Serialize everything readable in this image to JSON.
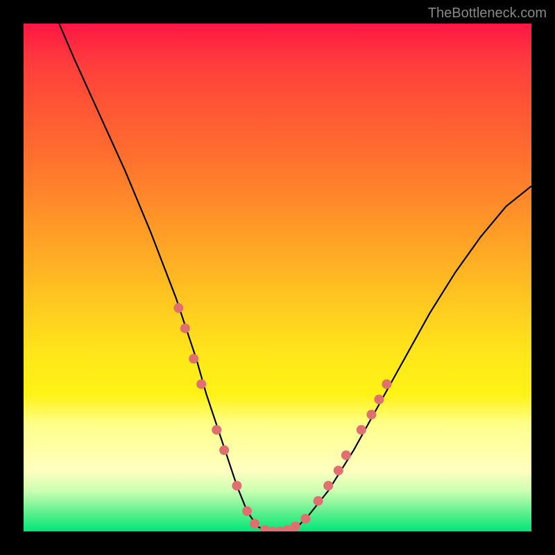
{
  "watermark": "TheBottleneck.com",
  "chart_data": {
    "type": "line",
    "title": "",
    "xlabel": "",
    "ylabel": "",
    "xlim": [
      0,
      100
    ],
    "ylim": [
      0,
      100
    ],
    "grid": false,
    "legend": false,
    "series": [
      {
        "name": "curve",
        "color": "#000000",
        "x": [
          7,
          10,
          15,
          20,
          25,
          30,
          32,
          34,
          36,
          38,
          40,
          42,
          44,
          46,
          48,
          50,
          52,
          54,
          56,
          60,
          65,
          70,
          75,
          80,
          85,
          90,
          95,
          100
        ],
        "y": [
          100,
          93,
          82,
          71,
          59,
          46,
          40,
          34,
          27,
          21,
          15,
          9,
          4,
          1,
          0,
          0,
          0,
          1,
          3,
          8,
          16,
          25,
          34,
          43,
          51,
          58,
          64,
          68
        ]
      }
    ],
    "points": [
      {
        "x": 30.5,
        "y": 44,
        "color": "#e07070"
      },
      {
        "x": 31.8,
        "y": 40,
        "color": "#e07070"
      },
      {
        "x": 33.5,
        "y": 34,
        "color": "#e07070"
      },
      {
        "x": 35.0,
        "y": 29,
        "color": "#e07070"
      },
      {
        "x": 38.0,
        "y": 20,
        "color": "#e07070"
      },
      {
        "x": 39.5,
        "y": 16,
        "color": "#e07070"
      },
      {
        "x": 42.0,
        "y": 9,
        "color": "#e07070"
      },
      {
        "x": 44.0,
        "y": 4,
        "color": "#e07070"
      },
      {
        "x": 45.5,
        "y": 1.5,
        "color": "#e07070"
      },
      {
        "x": 47.5,
        "y": 0.3,
        "color": "#e07070"
      },
      {
        "x": 49.0,
        "y": 0,
        "color": "#e07070"
      },
      {
        "x": 50.5,
        "y": 0,
        "color": "#e07070"
      },
      {
        "x": 52.0,
        "y": 0.3,
        "color": "#e07070"
      },
      {
        "x": 53.5,
        "y": 1,
        "color": "#e07070"
      },
      {
        "x": 55.5,
        "y": 2.5,
        "color": "#e07070"
      },
      {
        "x": 58.0,
        "y": 6,
        "color": "#e07070"
      },
      {
        "x": 60.0,
        "y": 9,
        "color": "#e07070"
      },
      {
        "x": 62.0,
        "y": 12,
        "color": "#e07070"
      },
      {
        "x": 63.5,
        "y": 15,
        "color": "#e07070"
      },
      {
        "x": 66.5,
        "y": 20,
        "color": "#e07070"
      },
      {
        "x": 68.5,
        "y": 23,
        "color": "#e07070"
      },
      {
        "x": 70.0,
        "y": 26,
        "color": "#e07070"
      },
      {
        "x": 71.5,
        "y": 29,
        "color": "#e07070"
      }
    ],
    "background": "rainbow-vertical"
  }
}
